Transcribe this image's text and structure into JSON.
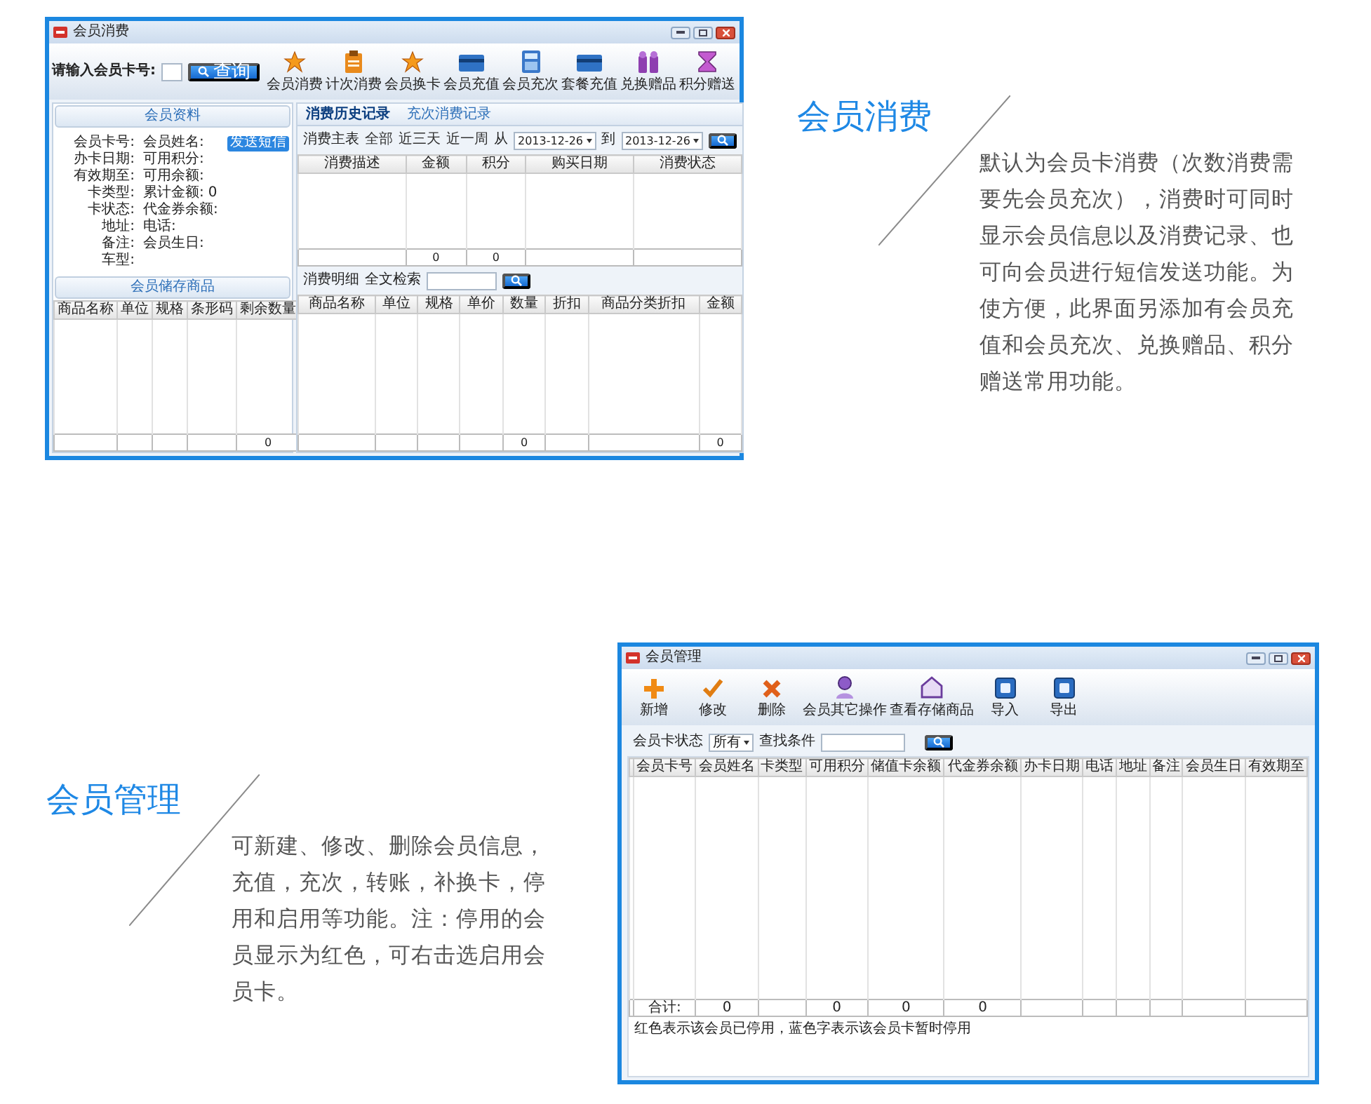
{
  "window_1": {
    "title": "会员消费",
    "search": {
      "label": "请输入会员卡号:",
      "button": "查询"
    },
    "toolbar": [
      {
        "label": "会员消费",
        "kind": "star"
      },
      {
        "label": "计次消费",
        "kind": "clipboard"
      },
      {
        "label": "会员换卡",
        "kind": "star"
      },
      {
        "label": "会员充值",
        "kind": "card"
      },
      {
        "label": "会员充次",
        "kind": "calculator"
      },
      {
        "label": "套餐充值",
        "kind": "card"
      },
      {
        "label": "兑换赠品",
        "kind": "gift"
      },
      {
        "label": "积分赠送",
        "kind": "hourglass"
      }
    ],
    "member_info": {
      "title": "会员资料",
      "sms_button": "发送短信",
      "fields_left": [
        {
          "label": "会员卡号:"
        },
        {
          "label": "办卡日期:"
        },
        {
          "label": "有效期至:"
        },
        {
          "label": "卡类型:"
        },
        {
          "label": "卡状态:"
        },
        {
          "label": "地址:"
        },
        {
          "label": "备注:"
        },
        {
          "label": "车型:"
        }
      ],
      "fields_right": [
        {
          "label": "会员姓名:"
        },
        {
          "label": "可用积分:"
        },
        {
          "label": "可用余额:"
        },
        {
          "label": "累计金额:",
          "value": "0"
        },
        {
          "label": "代金券余额:"
        },
        {
          "label": "电话:"
        },
        {
          "label": "会员生日:"
        }
      ]
    },
    "stored_goods": {
      "title": "会员储存商品",
      "columns": [
        "商品名称",
        "单位",
        "规格",
        "条形码",
        "剩余数量"
      ],
      "footer": [
        {
          "kind": "blank"
        },
        {
          "kind": "blank"
        },
        {
          "kind": "blank"
        },
        {
          "kind": "blank"
        },
        {
          "kind": "total",
          "text": "0"
        }
      ]
    },
    "tabs": [
      {
        "label": "消费历史记录",
        "selected": true
      },
      {
        "label": "充次消费记录",
        "selected": false
      }
    ],
    "history_filter": {
      "label": "消费主表",
      "ranges": [
        "全部",
        "近三天",
        "近一周"
      ],
      "from_label": "从",
      "from_date": "2013-12-26",
      "to_label": "到",
      "to_date": "2013-12-26"
    },
    "history_table": {
      "columns": [
        "消费描述",
        "金额",
        "积分",
        "购买日期",
        "消费状态"
      ],
      "footer": [
        {
          "kind": "blank"
        },
        {
          "kind": "total",
          "text": "0"
        },
        {
          "kind": "total",
          "text": "0"
        },
        {
          "kind": "blank"
        },
        {
          "kind": "blank"
        }
      ]
    },
    "detail_filter": {
      "label": "消费明细",
      "search_label": "全文检索"
    },
    "detail_table": {
      "columns": [
        "商品名称",
        "单位",
        "规格",
        "单价",
        "数量",
        "折扣",
        "商品分类折扣",
        "金额"
      ],
      "footer": [
        {
          "kind": "blank"
        },
        {
          "kind": "blank"
        },
        {
          "kind": "blank"
        },
        {
          "kind": "blank"
        },
        {
          "kind": "total",
          "text": "0"
        },
        {
          "kind": "blank"
        },
        {
          "kind": "blank"
        },
        {
          "kind": "total",
          "text": "0"
        }
      ]
    }
  },
  "feature_1": {
    "heading": "会员消费",
    "description": "默认为会员卡消费（次数消费需要先会员充次），消费时可同时显示会员信息以及消费记录、也可向会员进行短信发送功能。为使方便，此界面另添加有会员充值和会员充次、兑换赠品、积分赠送常用功能。"
  },
  "feature_2": {
    "heading": "会员管理",
    "description": "可新建、修改、删除会员信息，充值，充次，转账，补换卡，停用和启用等功能。注：停用的会员显示为红色，可右击选启用会员卡。"
  },
  "window_2": {
    "title": "会员管理",
    "toolbar": [
      {
        "label": "新增",
        "kind": "plus"
      },
      {
        "label": "修改",
        "kind": "check"
      },
      {
        "label": "删除",
        "kind": "cross"
      },
      {
        "label": "会员其它操作",
        "kind": "person"
      },
      {
        "label": "查看存储商品",
        "kind": "house"
      },
      {
        "label": "导入",
        "kind": "tray"
      },
      {
        "label": "导出",
        "kind": "tray"
      }
    ],
    "filter": {
      "status_label": "会员卡状态",
      "status_value": "所有",
      "search_label": "查找条件"
    },
    "table": {
      "columns": [
        "会员卡号",
        "会员姓名",
        "卡类型",
        "可用积分",
        "储值卡余额",
        "代金券余额",
        "办卡日期",
        "电话",
        "地址",
        "备注",
        "会员生日",
        "有效期至"
      ],
      "footer": [
        {
          "kind": "total",
          "text": "合计:"
        },
        {
          "kind": "total",
          "text": "0"
        },
        {
          "kind": "blank"
        },
        {
          "kind": "total",
          "text": "0"
        },
        {
          "kind": "total",
          "text": "0"
        },
        {
          "kind": "total",
          "text": "0"
        },
        {
          "kind": "blank"
        },
        {
          "kind": "blank"
        },
        {
          "kind": "blank"
        },
        {
          "kind": "blank"
        },
        {
          "kind": "blank"
        },
        {
          "kind": "blank"
        }
      ]
    },
    "status_text": "红色表示该会员已停用，蓝色字表示该会员卡暂时停用"
  }
}
